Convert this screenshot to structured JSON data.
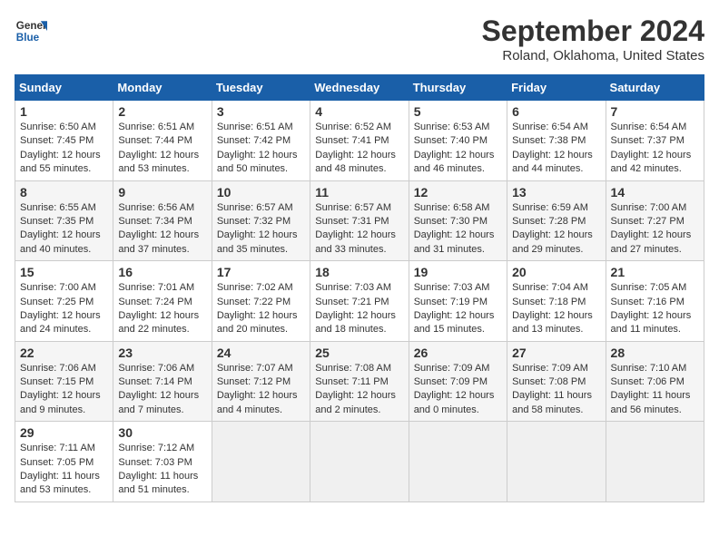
{
  "header": {
    "logo_line1": "General",
    "logo_line2": "Blue",
    "title": "September 2024",
    "subtitle": "Roland, Oklahoma, United States"
  },
  "columns": [
    "Sunday",
    "Monday",
    "Tuesday",
    "Wednesday",
    "Thursday",
    "Friday",
    "Saturday"
  ],
  "weeks": [
    [
      {
        "day": "1",
        "info": "Sunrise: 6:50 AM\nSunset: 7:45 PM\nDaylight: 12 hours\nand 55 minutes."
      },
      {
        "day": "2",
        "info": "Sunrise: 6:51 AM\nSunset: 7:44 PM\nDaylight: 12 hours\nand 53 minutes."
      },
      {
        "day": "3",
        "info": "Sunrise: 6:51 AM\nSunset: 7:42 PM\nDaylight: 12 hours\nand 50 minutes."
      },
      {
        "day": "4",
        "info": "Sunrise: 6:52 AM\nSunset: 7:41 PM\nDaylight: 12 hours\nand 48 minutes."
      },
      {
        "day": "5",
        "info": "Sunrise: 6:53 AM\nSunset: 7:40 PM\nDaylight: 12 hours\nand 46 minutes."
      },
      {
        "day": "6",
        "info": "Sunrise: 6:54 AM\nSunset: 7:38 PM\nDaylight: 12 hours\nand 44 minutes."
      },
      {
        "day": "7",
        "info": "Sunrise: 6:54 AM\nSunset: 7:37 PM\nDaylight: 12 hours\nand 42 minutes."
      }
    ],
    [
      {
        "day": "8",
        "info": "Sunrise: 6:55 AM\nSunset: 7:35 PM\nDaylight: 12 hours\nand 40 minutes."
      },
      {
        "day": "9",
        "info": "Sunrise: 6:56 AM\nSunset: 7:34 PM\nDaylight: 12 hours\nand 37 minutes."
      },
      {
        "day": "10",
        "info": "Sunrise: 6:57 AM\nSunset: 7:32 PM\nDaylight: 12 hours\nand 35 minutes."
      },
      {
        "day": "11",
        "info": "Sunrise: 6:57 AM\nSunset: 7:31 PM\nDaylight: 12 hours\nand 33 minutes."
      },
      {
        "day": "12",
        "info": "Sunrise: 6:58 AM\nSunset: 7:30 PM\nDaylight: 12 hours\nand 31 minutes."
      },
      {
        "day": "13",
        "info": "Sunrise: 6:59 AM\nSunset: 7:28 PM\nDaylight: 12 hours\nand 29 minutes."
      },
      {
        "day": "14",
        "info": "Sunrise: 7:00 AM\nSunset: 7:27 PM\nDaylight: 12 hours\nand 27 minutes."
      }
    ],
    [
      {
        "day": "15",
        "info": "Sunrise: 7:00 AM\nSunset: 7:25 PM\nDaylight: 12 hours\nand 24 minutes."
      },
      {
        "day": "16",
        "info": "Sunrise: 7:01 AM\nSunset: 7:24 PM\nDaylight: 12 hours\nand 22 minutes."
      },
      {
        "day": "17",
        "info": "Sunrise: 7:02 AM\nSunset: 7:22 PM\nDaylight: 12 hours\nand 20 minutes."
      },
      {
        "day": "18",
        "info": "Sunrise: 7:03 AM\nSunset: 7:21 PM\nDaylight: 12 hours\nand 18 minutes."
      },
      {
        "day": "19",
        "info": "Sunrise: 7:03 AM\nSunset: 7:19 PM\nDaylight: 12 hours\nand 15 minutes."
      },
      {
        "day": "20",
        "info": "Sunrise: 7:04 AM\nSunset: 7:18 PM\nDaylight: 12 hours\nand 13 minutes."
      },
      {
        "day": "21",
        "info": "Sunrise: 7:05 AM\nSunset: 7:16 PM\nDaylight: 12 hours\nand 11 minutes."
      }
    ],
    [
      {
        "day": "22",
        "info": "Sunrise: 7:06 AM\nSunset: 7:15 PM\nDaylight: 12 hours\nand 9 minutes."
      },
      {
        "day": "23",
        "info": "Sunrise: 7:06 AM\nSunset: 7:14 PM\nDaylight: 12 hours\nand 7 minutes."
      },
      {
        "day": "24",
        "info": "Sunrise: 7:07 AM\nSunset: 7:12 PM\nDaylight: 12 hours\nand 4 minutes."
      },
      {
        "day": "25",
        "info": "Sunrise: 7:08 AM\nSunset: 7:11 PM\nDaylight: 12 hours\nand 2 minutes."
      },
      {
        "day": "26",
        "info": "Sunrise: 7:09 AM\nSunset: 7:09 PM\nDaylight: 12 hours\nand 0 minutes."
      },
      {
        "day": "27",
        "info": "Sunrise: 7:09 AM\nSunset: 7:08 PM\nDaylight: 11 hours\nand 58 minutes."
      },
      {
        "day": "28",
        "info": "Sunrise: 7:10 AM\nSunset: 7:06 PM\nDaylight: 11 hours\nand 56 minutes."
      }
    ],
    [
      {
        "day": "29",
        "info": "Sunrise: 7:11 AM\nSunset: 7:05 PM\nDaylight: 11 hours\nand 53 minutes."
      },
      {
        "day": "30",
        "info": "Sunrise: 7:12 AM\nSunset: 7:03 PM\nDaylight: 11 hours\nand 51 minutes."
      },
      {
        "day": "",
        "info": ""
      },
      {
        "day": "",
        "info": ""
      },
      {
        "day": "",
        "info": ""
      },
      {
        "day": "",
        "info": ""
      },
      {
        "day": "",
        "info": ""
      }
    ]
  ]
}
